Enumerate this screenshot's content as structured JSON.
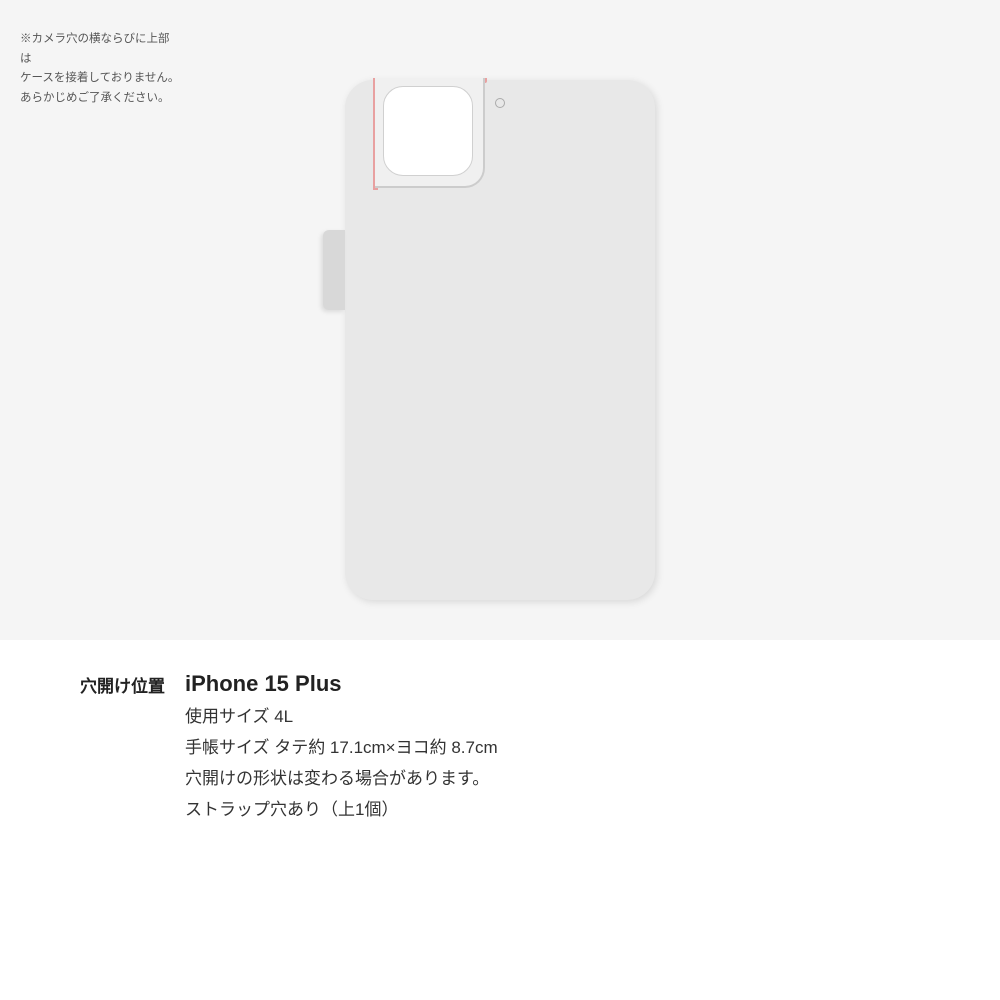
{
  "case_illustration": {
    "note_text_line1": "※カメラ穴の横ならびに上部は",
    "note_text_line2": "ケースを接着しておりません。",
    "note_text_line3": "あらかじめご了承ください。",
    "strap_hole_aria": "strap-hole"
  },
  "info_section": {
    "label": "穴開け位置",
    "device_name": "iPhone 15 Plus",
    "size_label": "使用サイズ 4L",
    "dimensions_label": "手帳サイズ タテ約 17.1cm×ヨコ約 8.7cm",
    "shape_note": "穴開けの形状は変わる場合があります。",
    "strap_note": "ストラップ穴あり（上1個）"
  },
  "colors": {
    "background": "#f5f5f5",
    "case_body": "#e8e8e8",
    "camera_accent": "#e8a0a0",
    "text_primary": "#222222",
    "text_secondary": "#555555"
  }
}
